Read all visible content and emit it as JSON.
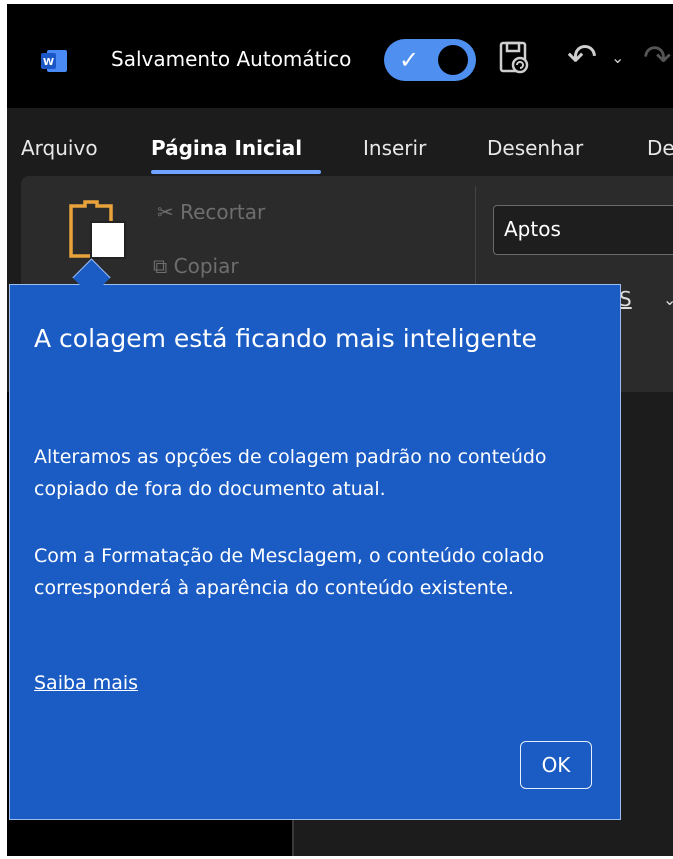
{
  "titlebar": {
    "app_icon": "word-logo",
    "autosave_label": "Salvamento Automático",
    "autosave_on": true,
    "icons": [
      "save-icon",
      "undo-icon",
      "chevron-down-icon",
      "redo-icon"
    ]
  },
  "tabs": [
    {
      "label": "Arquivo"
    },
    {
      "label": "Página Inicial",
      "active": true
    },
    {
      "label": "Inserir"
    },
    {
      "label": "Desenhar"
    },
    {
      "label": "De"
    }
  ],
  "ribbon": {
    "cut_label": "Recortar",
    "copy_label": "Copiar",
    "font_name": "Aptos",
    "font_partial": "S"
  },
  "callout": {
    "title": "A colagem está ficando mais inteligente",
    "paragraph1": "Alteramos as opções de colagem padrão no conteúdo copiado de fora do documento atual.",
    "paragraph2": "Com a Formatação de Mesclagem, o conteúdo colado corresponderá à aparência do conteúdo existente.",
    "link_label": "Saiba mais",
    "ok_label": "OK"
  },
  "colors": {
    "accent": "#1a5bc4",
    "toggle": "#4f8ff0",
    "background": "#1c1c1c"
  }
}
